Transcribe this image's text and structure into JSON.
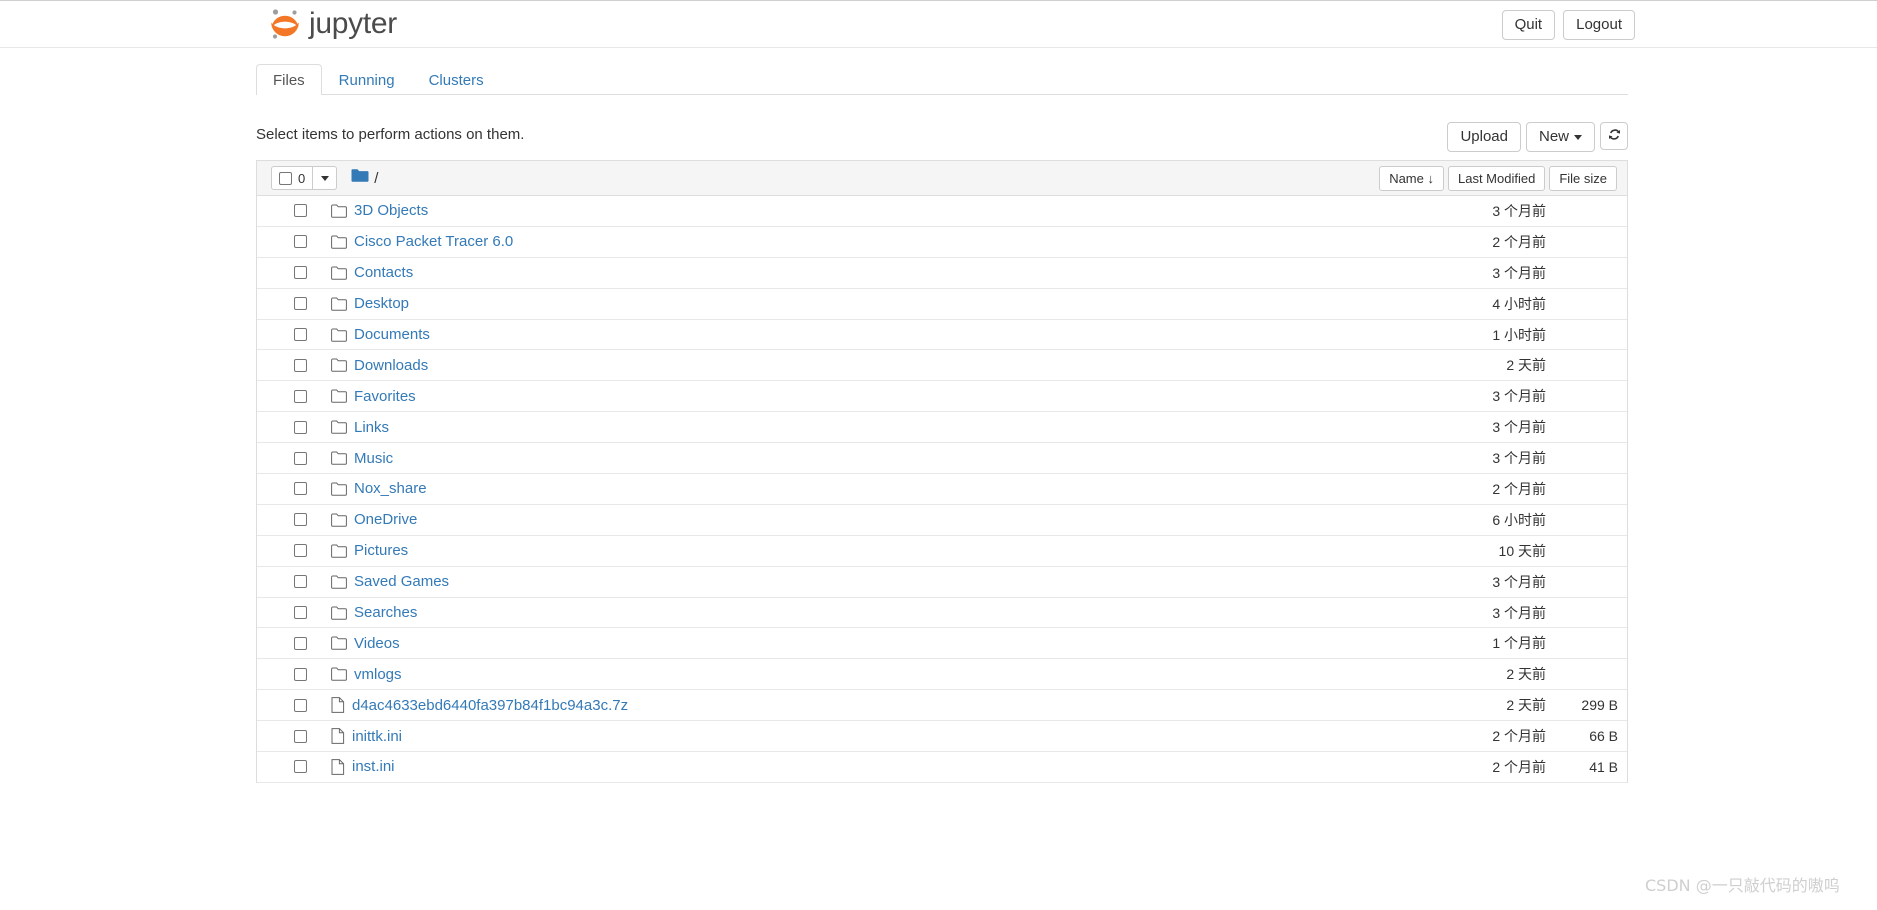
{
  "header": {
    "brand_text": "jupyter",
    "logo_icon": "jupyter-logo-icon",
    "buttons": [
      {
        "label": "Quit",
        "name": "quit-button"
      },
      {
        "label": "Logout",
        "name": "logout-button"
      }
    ]
  },
  "tabs": [
    {
      "label": "Files",
      "active": true
    },
    {
      "label": "Running",
      "active": false
    },
    {
      "label": "Clusters",
      "active": false
    }
  ],
  "toolbar": {
    "instruction": "Select items to perform actions on them.",
    "upload_label": "Upload",
    "new_label": "New",
    "refresh_icon": "refresh-icon"
  },
  "list_header": {
    "select_all_count": "0",
    "select_all_checkbox": "unchecked",
    "dropdown_icon": "caret-down-icon",
    "folder_icon": "folder-filled-icon",
    "breadcrumb_path": "/",
    "sort_buttons": [
      {
        "label": "Name ↓",
        "name": "sort-by-name-button"
      },
      {
        "label": "Last Modified",
        "name": "sort-by-modified-button"
      },
      {
        "label": "File size",
        "name": "sort-by-size-button"
      }
    ]
  },
  "rows": [
    {
      "icon": "folder-icon",
      "name": "3D Objects",
      "modified": "3 个月前",
      "size": ""
    },
    {
      "icon": "folder-icon",
      "name": "Cisco Packet Tracer 6.0",
      "modified": "2 个月前",
      "size": ""
    },
    {
      "icon": "folder-icon",
      "name": "Contacts",
      "modified": "3 个月前",
      "size": ""
    },
    {
      "icon": "folder-icon",
      "name": "Desktop",
      "modified": "4 小时前",
      "size": ""
    },
    {
      "icon": "folder-icon",
      "name": "Documents",
      "modified": "1 小时前",
      "size": ""
    },
    {
      "icon": "folder-icon",
      "name": "Downloads",
      "modified": "2 天前",
      "size": ""
    },
    {
      "icon": "folder-icon",
      "name": "Favorites",
      "modified": "3 个月前",
      "size": ""
    },
    {
      "icon": "folder-icon",
      "name": "Links",
      "modified": "3 个月前",
      "size": ""
    },
    {
      "icon": "folder-icon",
      "name": "Music",
      "modified": "3 个月前",
      "size": ""
    },
    {
      "icon": "folder-icon",
      "name": "Nox_share",
      "modified": "2 个月前",
      "size": ""
    },
    {
      "icon": "folder-icon",
      "name": "OneDrive",
      "modified": "6 小时前",
      "size": ""
    },
    {
      "icon": "folder-icon",
      "name": "Pictures",
      "modified": "10 天前",
      "size": ""
    },
    {
      "icon": "folder-icon",
      "name": "Saved Games",
      "modified": "3 个月前",
      "size": ""
    },
    {
      "icon": "folder-icon",
      "name": "Searches",
      "modified": "3 个月前",
      "size": ""
    },
    {
      "icon": "folder-icon",
      "name": "Videos",
      "modified": "1 个月前",
      "size": ""
    },
    {
      "icon": "folder-icon",
      "name": "vmlogs",
      "modified": "2 天前",
      "size": ""
    },
    {
      "icon": "file-icon",
      "name": "d4ac4633ebd6440fa397b84f1bc94a3c.7z",
      "modified": "2 天前",
      "size": "299 B"
    },
    {
      "icon": "file-icon",
      "name": "inittk.ini",
      "modified": "2 个月前",
      "size": "66 B"
    },
    {
      "icon": "file-icon",
      "name": "inst.ini",
      "modified": "2 个月前",
      "size": "41 B"
    }
  ],
  "watermark": "CSDN @一只敲代码的嗷呜",
  "colors": {
    "link": "#337ab7",
    "logo_orange": "#f37726",
    "folder_blue": "#337ab7",
    "border": "#dddddd",
    "header_bg": "#f5f5f5"
  }
}
